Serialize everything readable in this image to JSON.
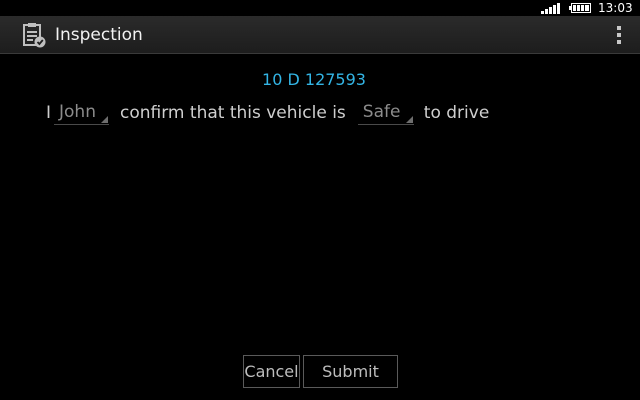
{
  "status_bar": {
    "time": "13:03",
    "signal_icon": "signal-icon",
    "battery_icon": "battery-icon"
  },
  "action_bar": {
    "icon": "clipboard-check-icon",
    "title": "Inspection",
    "overflow_icon": "overflow-menu-icon"
  },
  "vehicle": {
    "id": "10 D 127593"
  },
  "confirmation": {
    "prefix": "I",
    "name_value": "John",
    "middle": "confirm that this vehicle is",
    "status_value": "Safe",
    "suffix": "to drive"
  },
  "buttons": {
    "cancel_label": "Cancel",
    "submit_label": "Submit"
  },
  "colors": {
    "accent": "#33b5e5",
    "background": "#000000"
  }
}
